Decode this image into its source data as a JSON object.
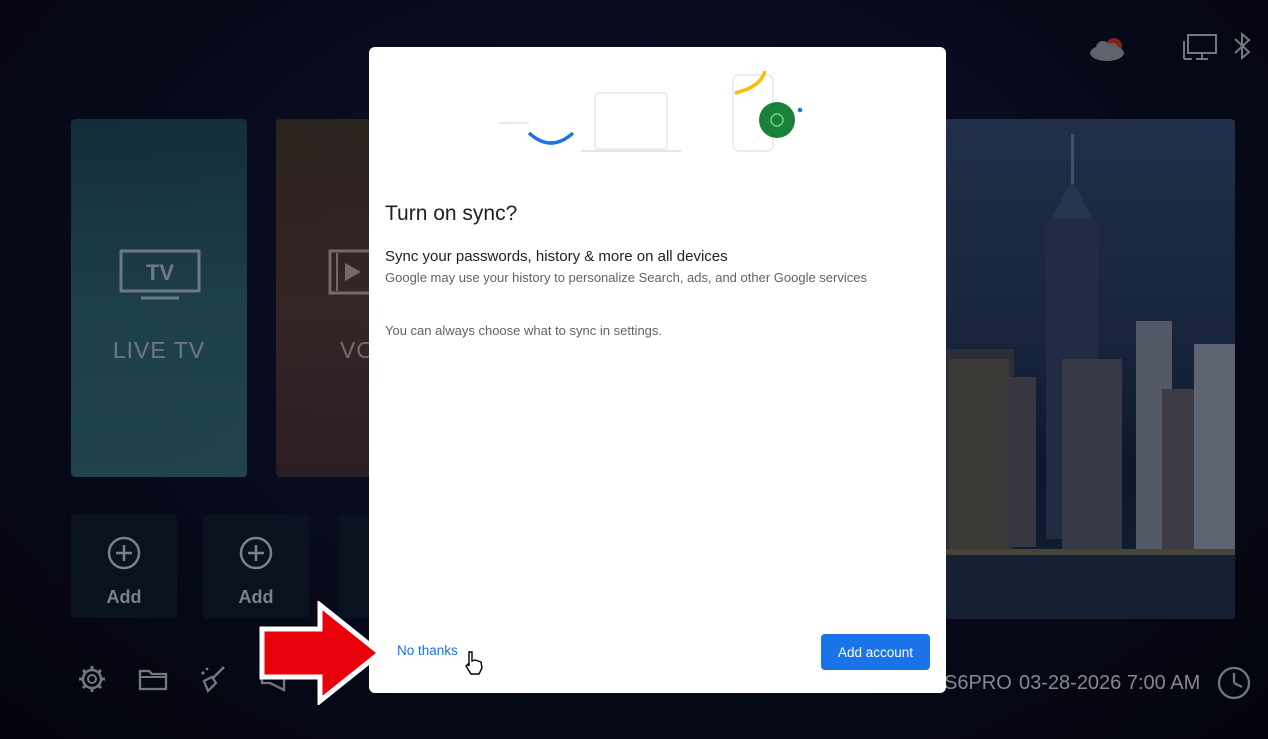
{
  "home": {
    "tiles": [
      {
        "label": "LIVE TV",
        "icon": "tv-icon"
      },
      {
        "label": "VO",
        "icon": "video-icon"
      }
    ],
    "add_tiles": [
      {
        "label": "Add",
        "icon": "plus-circle-icon"
      },
      {
        "label": "Add",
        "icon": "plus-circle-icon"
      }
    ],
    "bottom_bar": {
      "icons": [
        "gear-icon",
        "folder-icon",
        "broom-icon",
        "megaphone-icon"
      ],
      "device_name": "S6PRO",
      "datetime": "03-28-2026 7:00 AM",
      "clock_icon": "clock-icon"
    },
    "status_icons": [
      "cloud-icon",
      "network-icon",
      "bluetooth-icon"
    ]
  },
  "dialog": {
    "title": "Turn on sync?",
    "heading": "Sync your passwords, history & more on all devices",
    "subtext": "Google may use your history to personalize Search, ads, and other Google services",
    "note": "You can always choose what to sync in settings.",
    "secondary_button": "No thanks",
    "primary_button": "Add account"
  },
  "colors": {
    "primary": "#1a73e8",
    "annotation_arrow": "#e8000b",
    "dialog_background": "#ffffff"
  }
}
